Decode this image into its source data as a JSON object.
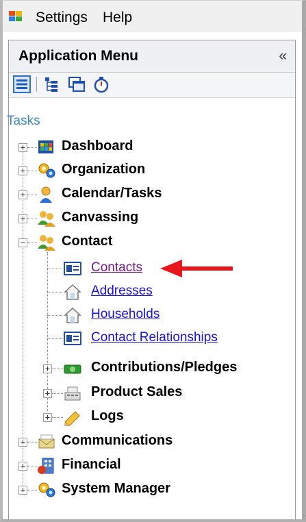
{
  "menubar": {
    "items": [
      "Settings",
      "Help"
    ]
  },
  "panel": {
    "title": "Application Menu",
    "collapse_glyph": "«"
  },
  "toolbar": {
    "icons": [
      "list-view-icon",
      "tree-view-icon",
      "windows-icon",
      "stopwatch-icon"
    ]
  },
  "section": {
    "label": "Tasks"
  },
  "tree": {
    "dashboard": "Dashboard",
    "organization": "Organization",
    "calendar": "Calendar/Tasks",
    "canvassing": "Canvassing",
    "contact": "Contact",
    "contacts": "Contacts",
    "addresses": "Addresses",
    "households": "Households",
    "contact_relationships": "Contact Relationships",
    "contributions": "Contributions/Pledges",
    "product_sales": "Product Sales",
    "logs": "Logs",
    "communications": "Communications",
    "financial": "Financial",
    "system_manager": "System Manager"
  },
  "colors": {
    "link": "#1a12d8",
    "visited_link": "#7a1a8a",
    "section": "#3a86c8",
    "arrow": "#e8151b"
  }
}
